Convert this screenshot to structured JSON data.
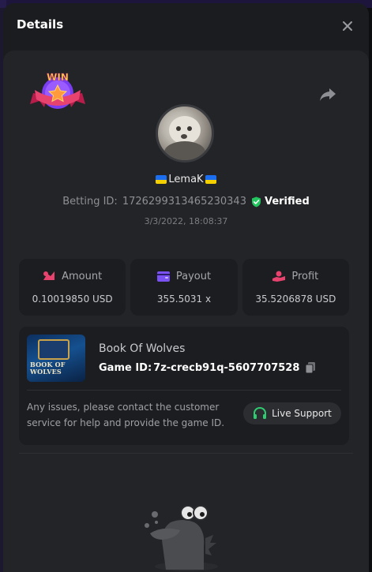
{
  "modal": {
    "title": "Details",
    "close_icon": "close-icon"
  },
  "bet": {
    "badge_text": "WIN",
    "username": "LemaK",
    "flag": "ukraine-flag",
    "betting_id_label": "Betting ID:",
    "betting_id": "1726299313465230343",
    "verified_label": "Verified",
    "datetime": "3/3/2022, 18:08:37"
  },
  "stats": [
    {
      "label": "Amount",
      "value": "0.10019850 USD",
      "icon": "coins-icon",
      "color": "#e8426e"
    },
    {
      "label": "Payout",
      "value": "355.5031 x",
      "icon": "wallet-icon",
      "color": "#7a52f4"
    },
    {
      "label": "Profit",
      "value": "35.5206878 USD",
      "icon": "hand-coin-icon",
      "color": "#e8426e"
    }
  ],
  "game": {
    "name": "Book Of Wolves",
    "thumb_title": "BOOK OF WOLVES",
    "id_label": "Game ID:",
    "id_value": "7z-crecb91q-5607707528",
    "support_text": "Any issues, please contact the customer service for help and provide the game ID.",
    "support_button": "Live Support"
  },
  "colors": {
    "accent_green": "#2ecc71",
    "verified_green": "#22c55e",
    "badge_pink": "#e8426e"
  }
}
